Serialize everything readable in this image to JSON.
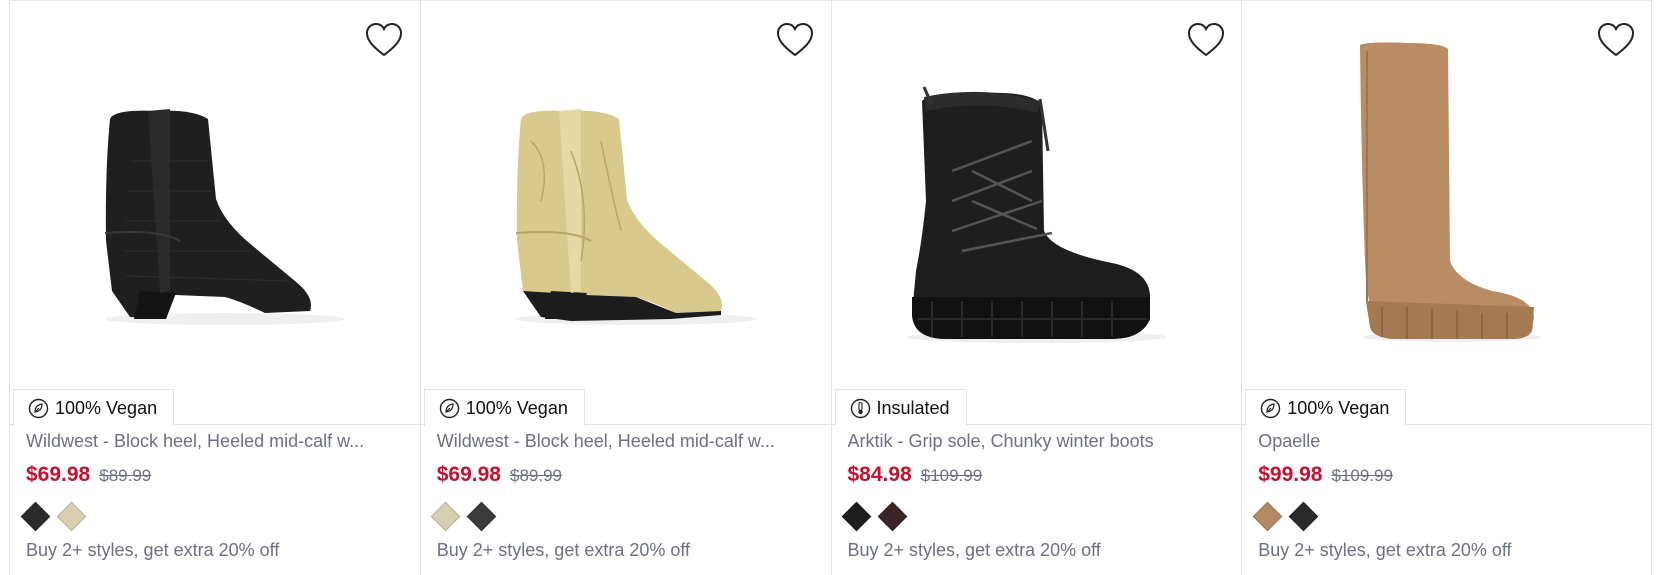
{
  "products": [
    {
      "badge": "100% Vegan",
      "badge_icon": "vegan-leaf-icon",
      "title": "Wildwest - Block heel, Heeled mid-calf w...",
      "price_sale": "$69.98",
      "price_original": "$89.99",
      "swatches": [
        "#2b2b2b",
        "#d8cfae"
      ],
      "promo": "Buy 2+ styles, get extra 20% off",
      "image": "black-croc-western-boot"
    },
    {
      "badge": "100% Vegan",
      "badge_icon": "vegan-leaf-icon",
      "title": "Wildwest - Block heel, Heeled mid-calf w...",
      "price_sale": "$69.98",
      "price_original": "$89.99",
      "swatches": [
        "#d8cfae",
        "#3a3a3a"
      ],
      "promo": "Buy 2+ styles, get extra 20% off",
      "image": "gold-metallic-western-boot"
    },
    {
      "badge": "Insulated",
      "badge_icon": "thermometer-icon",
      "title": "Arktik - Grip sole, Chunky winter boots",
      "price_sale": "$84.98",
      "price_original": "$109.99",
      "swatches": [
        "#1e1e1e",
        "#3a2426"
      ],
      "promo": "Buy 2+ styles, get extra 20% off",
      "image": "black-winter-lace-up-boot"
    },
    {
      "badge": "100% Vegan",
      "badge_icon": "vegan-leaf-icon",
      "title": "Opaelle",
      "price_sale": "$99.98",
      "price_original": "$109.99",
      "swatches": [
        "#b58a63",
        "#2a2a2a"
      ],
      "promo": "Buy 2+ styles, get extra 20% off",
      "image": "tan-knee-high-boot"
    }
  ]
}
